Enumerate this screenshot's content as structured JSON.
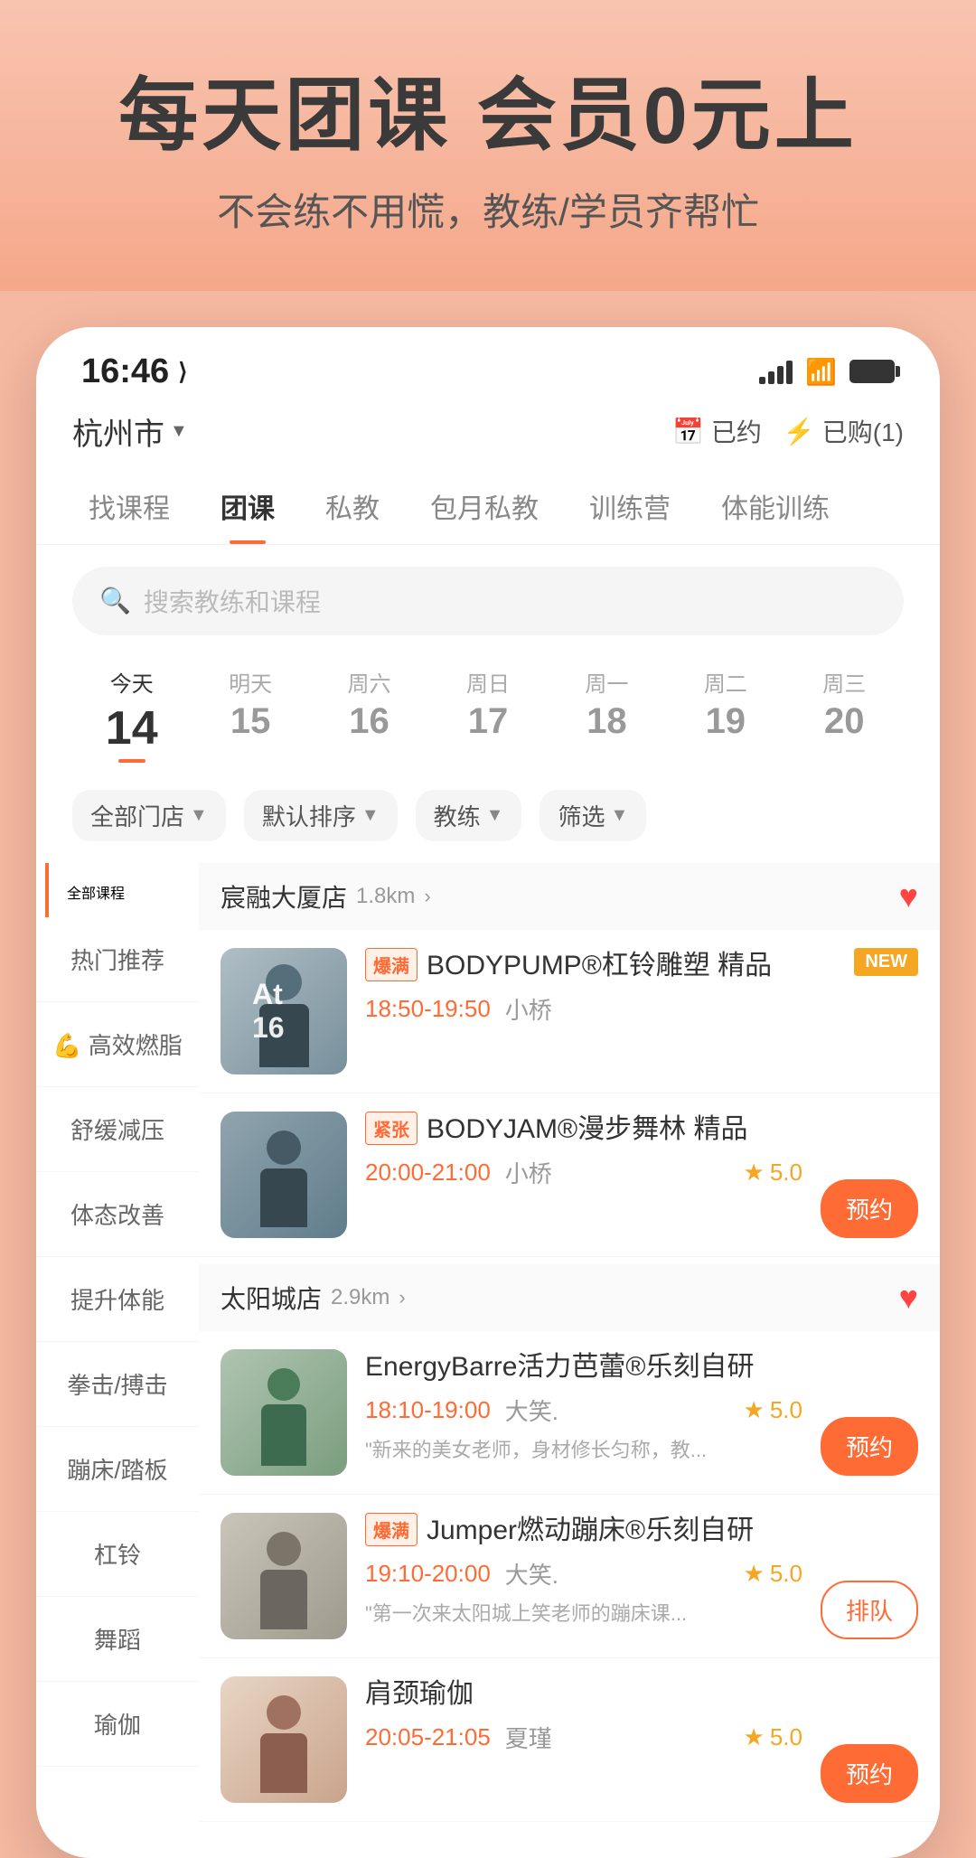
{
  "hero": {
    "title": "每天团课 会员0元上",
    "subtitle": "不会练不用慌，教练/学员齐帮忙"
  },
  "status_bar": {
    "time": "16:46",
    "location_icon": "◁"
  },
  "header": {
    "city": "杭州市",
    "booked_label": "已约",
    "purchased_label": "已购(1)"
  },
  "nav": {
    "tabs": [
      {
        "label": "找课程",
        "active": false
      },
      {
        "label": "团课",
        "active": true
      },
      {
        "label": "私教",
        "active": false
      },
      {
        "label": "包月私教",
        "active": false
      },
      {
        "label": "训练营",
        "active": false
      },
      {
        "label": "体能训练",
        "active": false
      }
    ]
  },
  "search": {
    "placeholder": "搜索教练和课程"
  },
  "dates": [
    {
      "label": "今天",
      "num": "14",
      "active": true
    },
    {
      "label": "明天",
      "num": "15",
      "active": false
    },
    {
      "label": "周六",
      "num": "16",
      "active": false
    },
    {
      "label": "周日",
      "num": "17",
      "active": false
    },
    {
      "label": "周一",
      "num": "18",
      "active": false
    },
    {
      "label": "周二",
      "num": "19",
      "active": false
    },
    {
      "label": "周三",
      "num": "20",
      "active": false
    }
  ],
  "filters": [
    {
      "label": "全部门店"
    },
    {
      "label": "默认排序"
    },
    {
      "label": "教练"
    },
    {
      "label": "筛选"
    }
  ],
  "categories": {
    "header": "全部课程",
    "items": [
      {
        "label": "热门推荐",
        "active": false
      },
      {
        "label": "💪 高效燃脂",
        "active": false
      },
      {
        "label": "舒缓减压",
        "active": false
      },
      {
        "label": "体态改善",
        "active": false
      },
      {
        "label": "提升体能",
        "active": false
      },
      {
        "label": "拳击/搏击",
        "active": false
      },
      {
        "label": "蹦床/踏板",
        "active": false
      },
      {
        "label": "杠铃",
        "active": false
      },
      {
        "label": "舞蹈",
        "active": false
      },
      {
        "label": "瑜伽",
        "active": false
      }
    ]
  },
  "gyms": [
    {
      "name": "宸融大厦店",
      "distance": "1.8km",
      "favorited": true,
      "courses": [
        {
          "tag": "爆满",
          "tag_type": "hot",
          "name": "BODYPUMP®杠铃雕塑 精品",
          "badge": "NEW",
          "time": "18:50-19:50",
          "trainer": "小桥",
          "rating": null,
          "action": null,
          "desc": null
        },
        {
          "tag": "紧张",
          "tag_type": "tight",
          "name": "BODYJAM®漫步舞林 精品",
          "badge": null,
          "time": "20:00-21:00",
          "trainer": "小桥",
          "rating": "5.0",
          "action": "预约",
          "desc": null
        }
      ]
    },
    {
      "name": "太阳城店",
      "distance": "2.9km",
      "favorited": true,
      "courses": [
        {
          "tag": null,
          "tag_type": null,
          "name": "EnergyBarre活力芭蕾®乐刻自研",
          "badge": null,
          "time": "18:10-19:00",
          "trainer": "大笑.",
          "rating": "5.0",
          "action": "预约",
          "desc": "\"新来的美女老师，身材修长匀称，教..."
        },
        {
          "tag": "爆满",
          "tag_type": "hot",
          "name": "Jumper燃动蹦床®乐刻自研",
          "badge": null,
          "time": "19:10-20:00",
          "trainer": "大笑.",
          "rating": "5.0",
          "action": "排队",
          "desc": "\"第一次来太阳城上笑老师的蹦床课..."
        },
        {
          "tag": null,
          "tag_type": null,
          "name": "肩颈瑜伽",
          "badge": null,
          "time": "20:05-21:05",
          "trainer": "夏瑾",
          "rating": "5.0",
          "action": "预约",
          "desc": null
        }
      ]
    }
  ],
  "at16_text": "At 16"
}
